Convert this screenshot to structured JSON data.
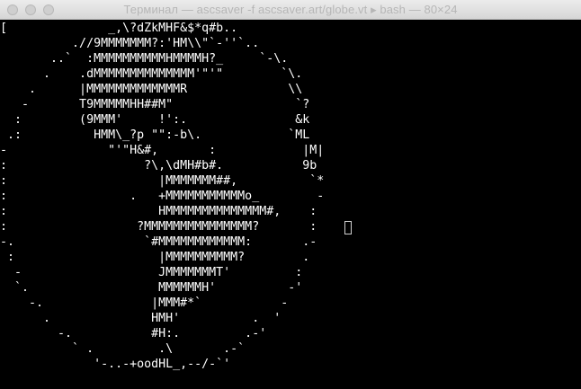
{
  "window": {
    "title": "Терминал — ascsaver -f ascsaver.art/globe.vt ▸ bash — 80×24"
  },
  "terminal": {
    "lines": [
      "[              _,\\?dZkMHF&$*q#b..",
      "          .//9MMMMMMM?:'HM\\\\\"`-''`..",
      "       ..`  :MMMMMMMMMMHMMMMH?_     `-\\.",
      "      .    .dMMMMMMMMMMMMMM'\"'\"        `\\.",
      "    .      |MMMMMMMMMMMMMR              \\\\",
      "   -       T9MMMMMHH##M\"                 `?",
      "  :        (9MMM'     !':.               &k",
      " .:          HMM\\_?p \"\":-b\\.            `ML",
      "-              \"'\"H&#,       :            |M|",
      ":                   ?\\,\\dMH#b#.           9b",
      ":                     |MMMMMMM##,          `*",
      ":                 .   +MMMMMMMMMMMo_        -",
      ":                     HMMMMMMMMMMMMMM#,    :",
      ":                  ?MMMMMMMMMMMMMMM?       :",
      "-.                  `#MMMMMMMMMMMM:       .-",
      " :                    |MMMMMMMMMM?        .",
      "  -                   JMMMMMMMT'         :",
      "  `.                  MMMMMMH'          -'",
      "    -.               |MMM#*`           -",
      "      .              HMH'          .  '",
      "        -.           #H:.         .-'",
      "          ` .         .\\       .-`",
      "             '-..-+oodHL_,--/-`'"
    ]
  }
}
